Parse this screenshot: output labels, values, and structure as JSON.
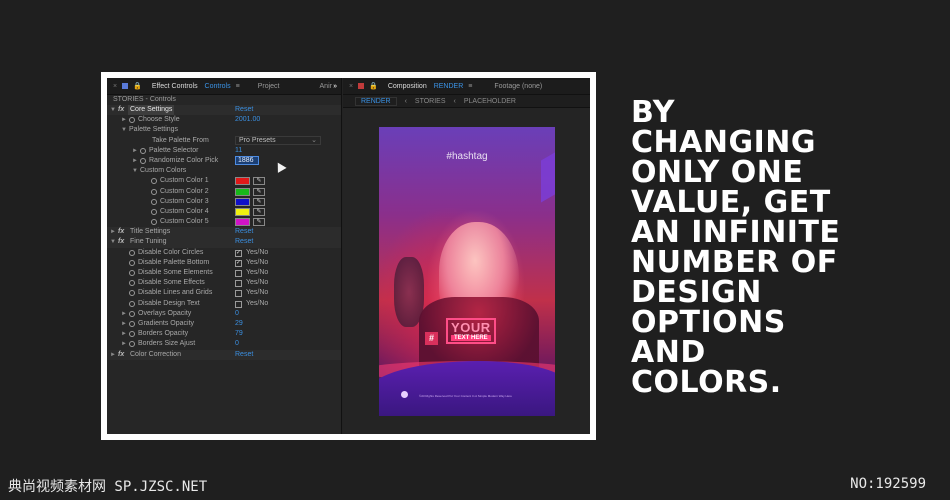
{
  "headline": {
    "lines": [
      "BY",
      "CHANGING",
      "ONLY ONE",
      "VALUE, GET",
      "AN INFINITE",
      "NUMBER OF",
      "DESIGN",
      "OPTIONS",
      "AND",
      "COLORS."
    ]
  },
  "watermark": {
    "left": "典尚视频素材网 SP.JZSC.NET",
    "right": "NO:192599"
  },
  "effect_panel": {
    "tab_effect_controls": "Effect Controls",
    "tab_effect_controls_name": "Controls",
    "tab_project": "Project",
    "tab_anim": "Anir",
    "panel_title": "STORIES - Controls",
    "core_settings": "Core Settings",
    "reset": "Reset",
    "choose_style": "Choose Style",
    "choose_style_value": "2001.00",
    "palette_settings": "Palette Settings",
    "take_palette_from": "Take Palette From",
    "take_palette_value": "Pro Presets",
    "palette_selector": "Palette Selector",
    "palette_selector_value": "11",
    "randomize_color_pick": "Randomize Color Pick",
    "randomize_value": "1886",
    "custom_colors": "Custom Colors",
    "custom_color_labels": [
      "Custom Color 1",
      "Custom Color 2",
      "Custom Color 3",
      "Custom Color 4",
      "Custom Color 5"
    ],
    "custom_color_values": [
      "#e01818",
      "#17b81a",
      "#1010c8",
      "#f0f010",
      "#d014c8"
    ],
    "title_settings": "Title Settings",
    "fine_tuning": "Fine Tuning",
    "checkbox_rows": [
      {
        "label": "Disable Color Circles",
        "checked": true
      },
      {
        "label": "Disable Palette Bottom",
        "checked": true
      },
      {
        "label": "Disable Some Elements",
        "checked": false
      },
      {
        "label": "Disable Some Effects",
        "checked": false
      },
      {
        "label": "Disable Lines and Grids",
        "checked": false
      },
      {
        "label": "Disable Design Text",
        "checked": false
      }
    ],
    "yes_no": "Yes/No",
    "overlays_opacity": "Overlays Opacity",
    "overlays_opacity_value": "0",
    "gradients_opacity": "Gradients Opacity",
    "gradients_opacity_value": "29",
    "borders_opacity": "Borders Opacity",
    "borders_opacity_value": "79",
    "borders_size": "Borders Size Ajust",
    "borders_size_value": "0",
    "color_correction": "Color Correction"
  },
  "composition_panel": {
    "tab_composition": "Composition",
    "tab_composition_name": "RENDER",
    "tab_footage": "Footage (none)",
    "crumbs": [
      "RENDER",
      "STORIES",
      "PLACEHOLDER"
    ],
    "hashtag": "#hashtag",
    "your": "YOUR",
    "text_here": "TEXT HERE",
    "hash_symbol": "#",
    "credit": "©All Rights Reserved Put Your Content In A Simple Modern Way Here"
  }
}
